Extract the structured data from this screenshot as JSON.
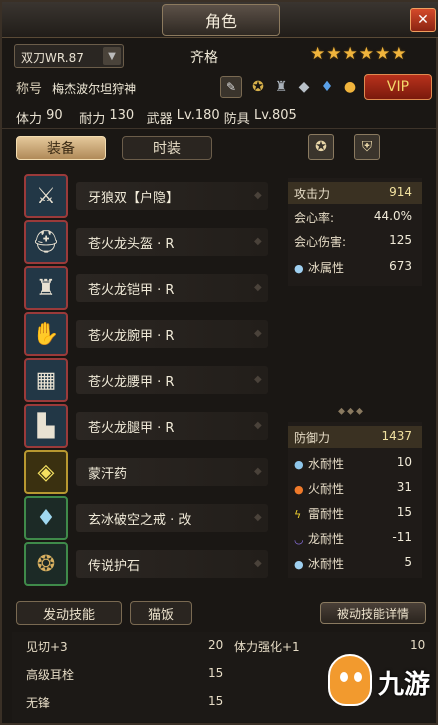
{
  "window": {
    "title": "角色",
    "close_icon": "close-x"
  },
  "header": {
    "weapon_select": "双刀WR.87",
    "player_name": "齐格",
    "stars": 6,
    "title_label": "称号",
    "title_value": "梅杰波尔坦狩神",
    "vip_label": "VIP",
    "stats": {
      "hp_label": "体力",
      "hp": "90",
      "stamina_label": "耐力",
      "stamina": "130",
      "weapon_label": "武器",
      "weapon_lv": "Lv.180",
      "armor_label": "防具",
      "armor_lv": "Lv.805"
    }
  },
  "tabs": {
    "equipment": "装备",
    "fashion": "时装"
  },
  "equipment": [
    {
      "name": "牙狼双【户隐】",
      "icon": "dual-blades-icon",
      "frame": "red"
    },
    {
      "name": "苍火龙头盔 · R",
      "icon": "helmet-icon",
      "frame": "red"
    },
    {
      "name": "苍火龙铠甲 · R",
      "icon": "chest-armor-icon",
      "frame": "red"
    },
    {
      "name": "苍火龙腕甲 · R",
      "icon": "gauntlet-icon",
      "frame": "red"
    },
    {
      "name": "苍火龙腰甲 · R",
      "icon": "waist-armor-icon",
      "frame": "red"
    },
    {
      "name": "苍火龙腿甲 · R",
      "icon": "leg-armor-icon",
      "frame": "red"
    },
    {
      "name": "蒙汗药",
      "icon": "potion-icon",
      "frame": "yellow"
    },
    {
      "name": "玄冰破空之戒 · 改",
      "icon": "ring-gem-icon",
      "frame": "green"
    },
    {
      "name": "传说护石",
      "icon": "talisman-icon",
      "frame": "green"
    }
  ],
  "offense": [
    {
      "label": "攻击力",
      "value": "914",
      "highlight": true
    },
    {
      "label": "会心率:",
      "value": "44.0%"
    },
    {
      "label": "会心伤害:",
      "value": "125"
    },
    {
      "label": "冰属性",
      "value": "673",
      "icon": "ice-drop-icon"
    }
  ],
  "defense": [
    {
      "label": "防御力",
      "value": "1437",
      "highlight": true
    },
    {
      "label": "水耐性",
      "value": "10",
      "icon": "water-icon"
    },
    {
      "label": "火耐性",
      "value": "31",
      "icon": "fire-icon"
    },
    {
      "label": "雷耐性",
      "value": "15",
      "icon": "thunder-icon"
    },
    {
      "label": "龙耐性",
      "value": "-11",
      "icon": "dragon-icon"
    },
    {
      "label": "冰耐性",
      "value": "5",
      "icon": "ice-drop-icon"
    }
  ],
  "skills_bar": {
    "active": "发动技能",
    "cat": "猫饭",
    "passive": "被动技能详情"
  },
  "skills": [
    {
      "name": "见切+3",
      "points": "20"
    },
    {
      "name": "高级耳栓",
      "points": "15"
    },
    {
      "name": "无锋",
      "points": "15"
    }
  ],
  "skills_right": [
    {
      "name": "体力强化+1",
      "points": "10"
    }
  ],
  "watermark": "九游",
  "colors": {
    "accent": "#f0b43c",
    "vip": "#b8321c",
    "frame_red": "#9b3a3a"
  }
}
